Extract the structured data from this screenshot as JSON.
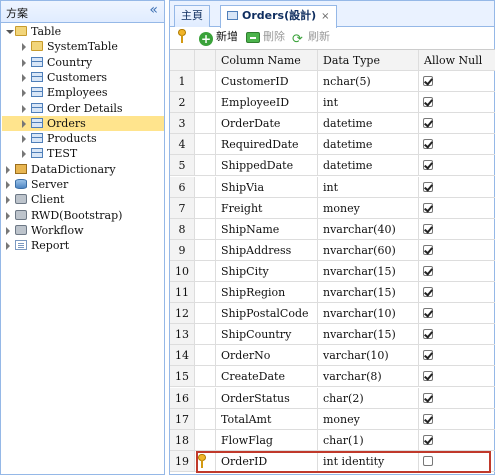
{
  "left_panel": {
    "title": "方案",
    "collapse_glyph": "«",
    "tree": [
      {
        "label": "Table",
        "icon": "table-folder-icon",
        "expanded": true,
        "indent": 0
      },
      {
        "label": "SystemTable",
        "icon": "folder-icon",
        "indent": 1
      },
      {
        "label": "Country",
        "icon": "table-icon",
        "indent": 1
      },
      {
        "label": "Customers",
        "icon": "table-icon",
        "indent": 1
      },
      {
        "label": "Employees",
        "icon": "table-icon",
        "indent": 1
      },
      {
        "label": "Order Details",
        "icon": "table-icon",
        "indent": 1
      },
      {
        "label": "Orders",
        "icon": "table-icon",
        "indent": 1,
        "selected": true
      },
      {
        "label": "Products",
        "icon": "table-icon",
        "indent": 1
      },
      {
        "label": "TEST",
        "icon": "table-icon",
        "indent": 1
      },
      {
        "label": "DataDictionary",
        "icon": "box-icon",
        "indent": 0
      },
      {
        "label": "Server",
        "icon": "database-icon",
        "indent": 0
      },
      {
        "label": "Client",
        "icon": "gear-icon",
        "indent": 0
      },
      {
        "label": "RWD(Bootstrap)",
        "icon": "gear-icon",
        "indent": 0
      },
      {
        "label": "Workflow",
        "icon": "gear-icon",
        "indent": 0
      },
      {
        "label": "Report",
        "icon": "page-icon",
        "indent": 0
      }
    ]
  },
  "tabs": [
    {
      "label": "主頁",
      "active": false
    },
    {
      "label": "Orders(設計)",
      "active": true,
      "close": "×"
    }
  ],
  "toolbar": {
    "add_label": "新增",
    "delete_label": "刪除",
    "refresh_label": "刷新"
  },
  "grid": {
    "headers": [
      "",
      "",
      "Column Name",
      "Data Type",
      "Allow Null"
    ],
    "rows": [
      {
        "n": "1",
        "name": "CustomerID",
        "type": "nchar(5)",
        "null": true
      },
      {
        "n": "2",
        "name": "EmployeeID",
        "type": "int",
        "null": true
      },
      {
        "n": "3",
        "name": "OrderDate",
        "type": "datetime",
        "null": true
      },
      {
        "n": "4",
        "name": "RequiredDate",
        "type": "datetime",
        "null": true
      },
      {
        "n": "5",
        "name": "ShippedDate",
        "type": "datetime",
        "null": true
      },
      {
        "n": "6",
        "name": "ShipVia",
        "type": "int",
        "null": true
      },
      {
        "n": "7",
        "name": "Freight",
        "type": "money",
        "null": true
      },
      {
        "n": "8",
        "name": "ShipName",
        "type": "nvarchar(40)",
        "null": true
      },
      {
        "n": "9",
        "name": "ShipAddress",
        "type": "nvarchar(60)",
        "null": true
      },
      {
        "n": "10",
        "name": "ShipCity",
        "type": "nvarchar(15)",
        "null": true
      },
      {
        "n": "11",
        "name": "ShipRegion",
        "type": "nvarchar(15)",
        "null": true
      },
      {
        "n": "12",
        "name": "ShipPostalCode",
        "type": "nvarchar(10)",
        "null": true
      },
      {
        "n": "13",
        "name": "ShipCountry",
        "type": "nvarchar(15)",
        "null": true
      },
      {
        "n": "14",
        "name": "OrderNo",
        "type": "varchar(10)",
        "null": true
      },
      {
        "n": "15",
        "name": "CreateDate",
        "type": "varchar(8)",
        "null": true
      },
      {
        "n": "16",
        "name": "OrderStatus",
        "type": "char(2)",
        "null": true
      },
      {
        "n": "17",
        "name": "TotalAmt",
        "type": "money",
        "null": true
      },
      {
        "n": "18",
        "name": "FlowFlag",
        "type": "char(1)",
        "null": true
      },
      {
        "n": "19",
        "name": "OrderID",
        "type": "int identity",
        "null": false,
        "key": true
      }
    ]
  },
  "colors": {
    "selection": "#ffe48d",
    "panel_border": "#95b8e7",
    "highlight_border": "#c0392b"
  }
}
